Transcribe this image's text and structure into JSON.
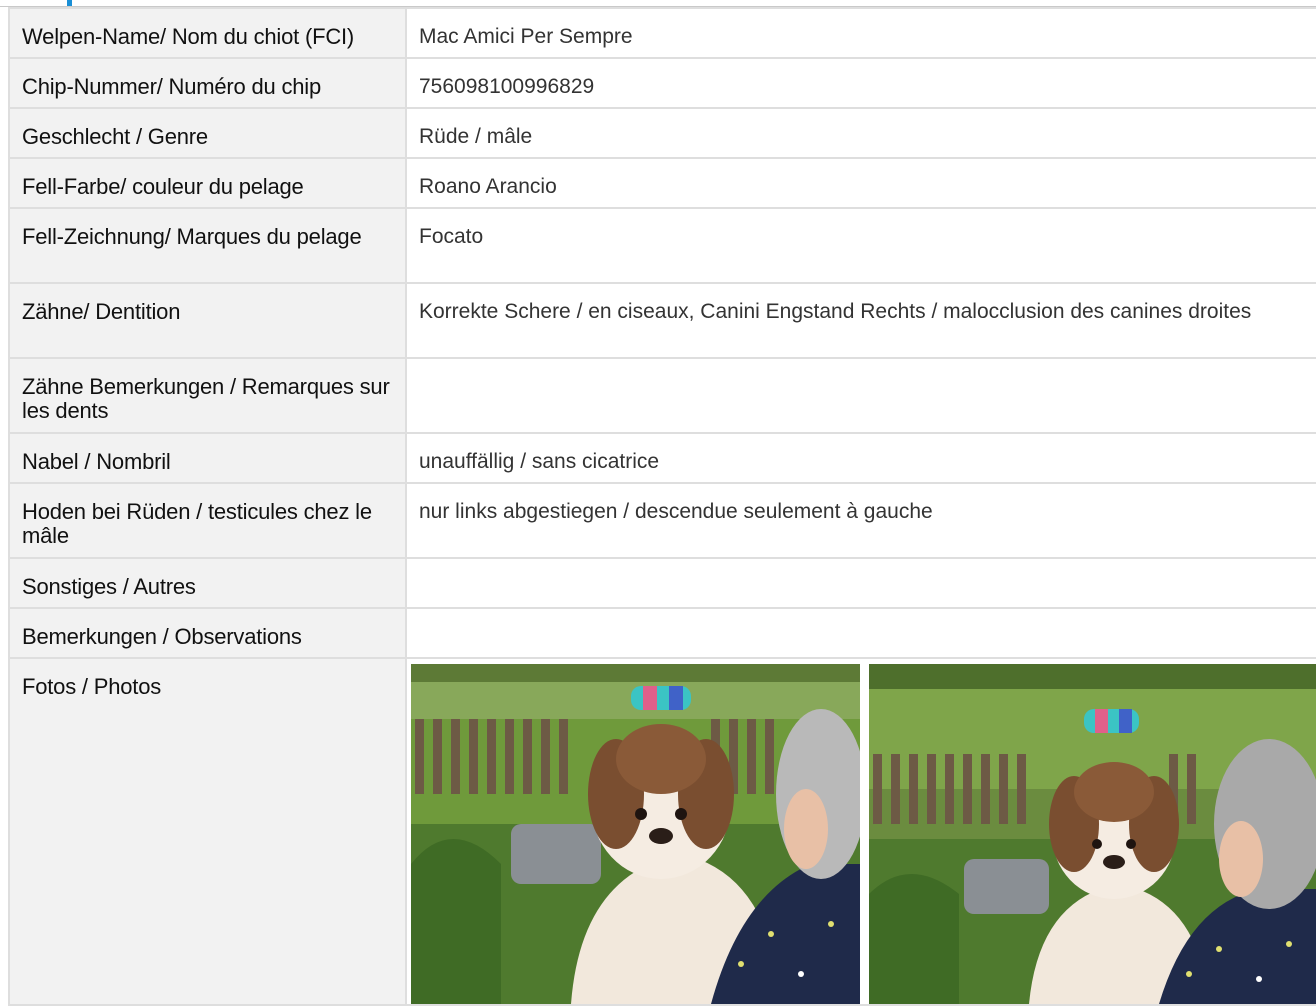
{
  "rows": [
    {
      "label": "Welpen-Name/ Nom du chiot (FCI)",
      "value": "Mac Amici Per Sempre"
    },
    {
      "label": "Chip-Nummer/ Numéro du chip",
      "value": "756098100996829"
    },
    {
      "label": "Geschlecht / Genre",
      "value": "Rüde / mâle"
    },
    {
      "label": "Fell-Farbe/ couleur du pelage",
      "value": "Roano Arancio"
    },
    {
      "label": "Fell-Zeichnung/ Marques du pelage",
      "value": "Focato"
    },
    {
      "label": "Zähne/ Dentition",
      "value": "Korrekte Schere / en ciseaux, Canini Engstand Rechts / malocclusion des canines droites"
    },
    {
      "label": "Zähne Bemerkungen / Remarques sur les dents",
      "value": ""
    },
    {
      "label": "Nabel / Nombril",
      "value": "unauffällig / sans cicatrice"
    },
    {
      "label": "Hoden bei Rüden / testicules chez le mâle",
      "value": "nur links abgestiegen / descendue seulement à gauche"
    },
    {
      "label": "Sonstiges / Autres",
      "value": ""
    },
    {
      "label": "Bemerkungen / Observations",
      "value": ""
    }
  ],
  "photos": {
    "label": "Fotos / Photos",
    "images": [
      {
        "subject": "puppy-on-shoulder-photo"
      },
      {
        "subject": "puppy-on-shoulder-photo"
      }
    ]
  },
  "colors": {
    "accent": "#1a8fd6",
    "label_bg": "#f2f2f2",
    "border": "#dedede"
  }
}
